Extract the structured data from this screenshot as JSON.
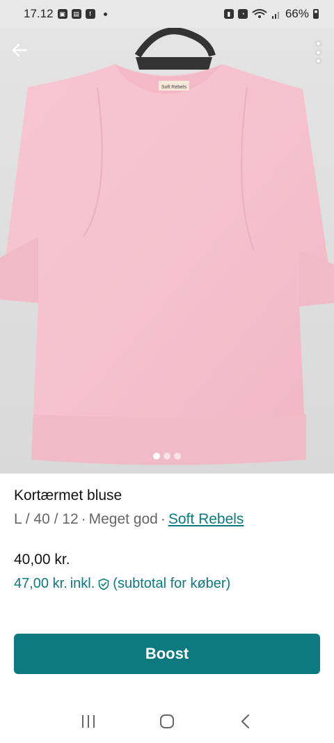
{
  "status_bar": {
    "time": "17.12",
    "battery_text": "66%"
  },
  "product": {
    "title": "Kortærmet bluse",
    "size": "L / 40 / 12",
    "separator": "·",
    "condition": "Meget god",
    "brand": "Soft Rebels",
    "price": "40,00 kr.",
    "price_incl": "47,00 kr.",
    "incl_label": "inkl.",
    "incl_note": "(subtotal for køber)"
  },
  "carousel": {
    "count": 3,
    "active_index": 0
  },
  "actions": {
    "boost_label": "Boost"
  },
  "colors": {
    "accent": "#0d7a80",
    "link": "#0a7a80",
    "shirt": "#f6c2cf"
  },
  "icons": {
    "back": "arrow-left-icon",
    "more": "more-vertical-icon",
    "shield": "shield-check-icon",
    "nav_recent": "recent-apps-icon",
    "nav_home": "home-icon",
    "nav_back": "nav-back-icon"
  }
}
